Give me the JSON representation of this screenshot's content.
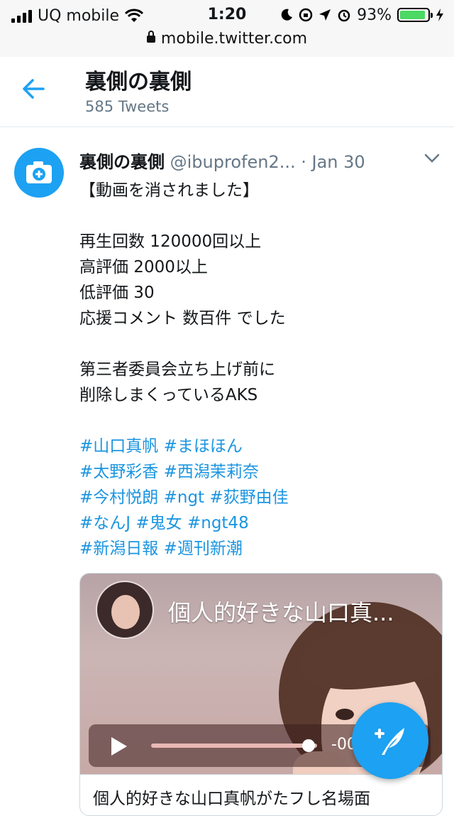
{
  "status_bar": {
    "carrier": "UQ mobile",
    "time": "1:20",
    "battery": "93%",
    "battery_level": 0.93,
    "url": "mobile.twitter.com"
  },
  "header": {
    "title": "裏側の裏側",
    "subtitle": "585 Tweets"
  },
  "tweet": {
    "name": "裏側の裏側",
    "handle": "@ibuprofen2...",
    "dot": "·",
    "date": "Jan 30",
    "lines": [
      "【動画を消されました】",
      "再生回数 120000回以上",
      "高評価 2000以上",
      "低評価 30",
      "応援コメント 数百件 でした",
      "第三者委員会立ち上げ前に",
      "削除しまくっているAKS"
    ],
    "hashtags": [
      "#山口真帆",
      "#まほほん",
      "#太野彩香",
      "#西潟茉莉奈",
      "#今村悦朗",
      "#ngt",
      "#荻野由佳",
      "#なんJ",
      "#鬼女",
      "#ngt48",
      "#新潟日報",
      "#週刊新潮"
    ]
  },
  "card": {
    "video_title": "個人的好きな山口真...",
    "time": "-00",
    "progress": 0.95,
    "bottom_title": "個人的好きな山口真帆がたフし名場面"
  },
  "colors": {
    "accent": "#1da1f2",
    "link": "#1b95e0",
    "muted": "#657786"
  },
  "icons": [
    "back-arrow-icon",
    "camera-plus-icon",
    "chevron-down-icon",
    "play-icon",
    "compose-tweet-icon",
    "wifi-icon",
    "lock-icon"
  ]
}
